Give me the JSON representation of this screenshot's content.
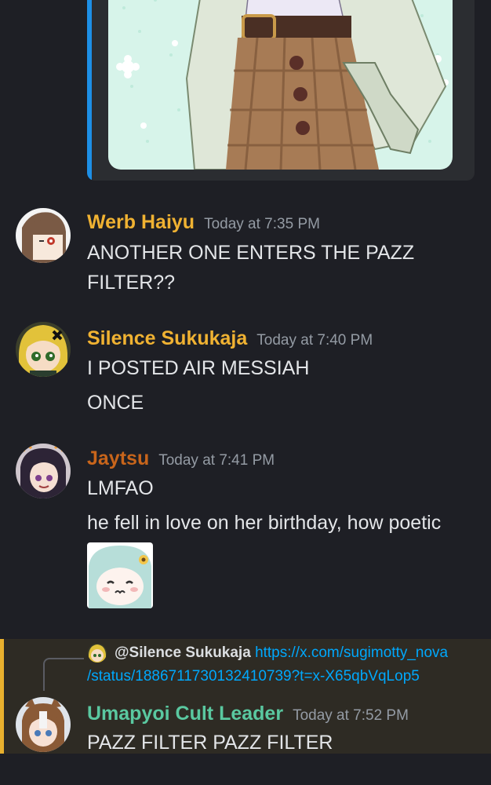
{
  "messages": [
    {
      "username": "Werb Haiyu",
      "username_color": "#f0b232",
      "timestamp": "Today at 7:35 PM",
      "lines": [
        "ANOTHER ONE ENTERS THE PAZZ",
        "FILTER??"
      ]
    },
    {
      "username": "Silence Sukukaja",
      "username_color": "#f0b232",
      "timestamp": "Today at 7:40 PM",
      "lines": [
        "I POSTED AIR MESSIAH",
        "ONCE"
      ]
    },
    {
      "username": "Jaytsu",
      "username_color": "#c8651b",
      "timestamp": "Today at 7:41 PM",
      "lines": [
        "LMFAO",
        "he fell in love on her birthday, how poetic"
      ]
    },
    {
      "username": "Umapyoi Cult Leader",
      "username_color": "#5ac8a0",
      "timestamp": "Today at 7:52 PM",
      "lines": [
        "PAZZ FILTER PAZZ FILTER"
      ],
      "reply": {
        "mention": "@Silence Sukukaja",
        "link_part1": "https://x.com/sugimotty_nova",
        "link_part2": "/status/1886711730132410739?t=x-X65qbVqLop5"
      }
    }
  ]
}
